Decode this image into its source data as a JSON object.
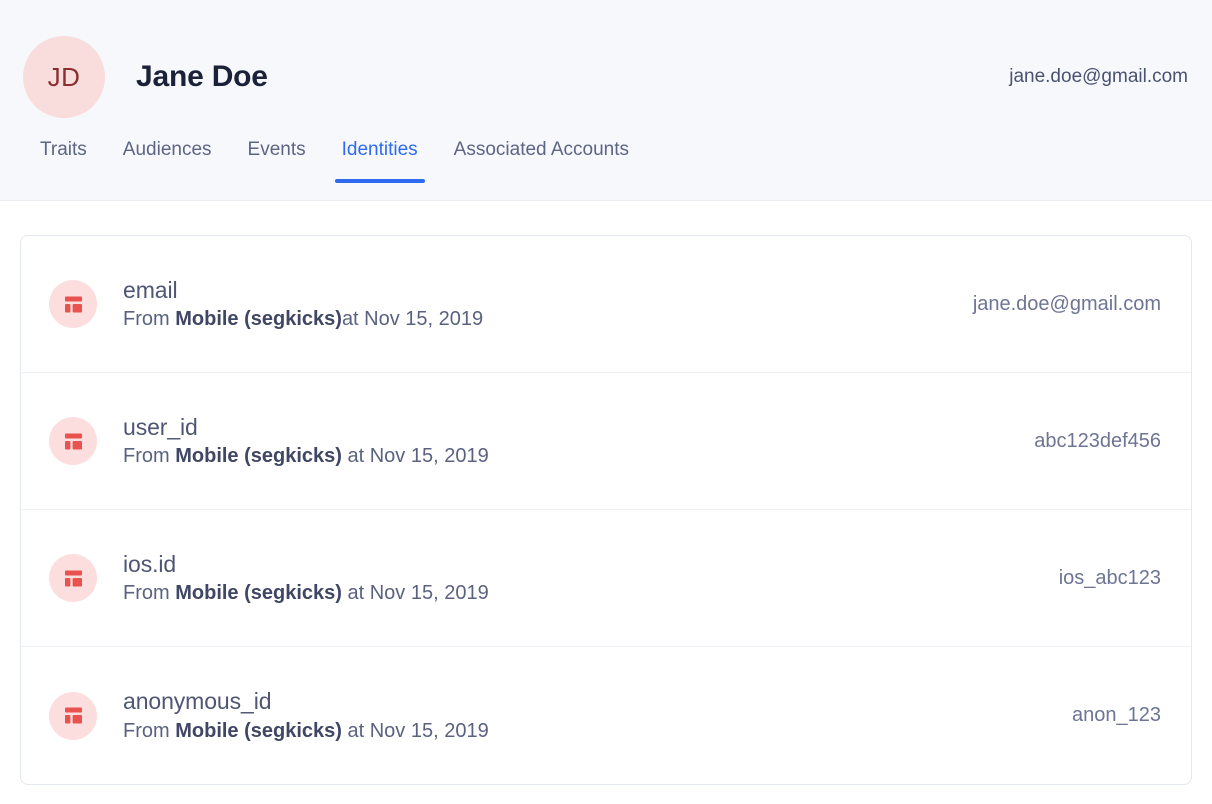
{
  "header": {
    "avatar_initials": "JD",
    "name": "Jane Doe",
    "email": "jane.doe@gmail.com",
    "background_color": "#f7f8fc",
    "avatar_bg_color": "#f9dcdc",
    "avatar_text_color": "#8a2f2f"
  },
  "tabs": {
    "active_color": "#2f6bf0",
    "inactive_color": "#5c6585",
    "items": [
      {
        "label": "Traits",
        "active": false
      },
      {
        "label": "Audiences",
        "active": false
      },
      {
        "label": "Events",
        "active": false
      },
      {
        "label": "Identities",
        "active": true
      },
      {
        "label": "Associated Accounts",
        "active": false
      }
    ]
  },
  "identities": {
    "icon_name": "layout-dashboard-icon",
    "icon_color": "#e8534f",
    "icon_bg_color": "#fbdedd",
    "rows": [
      {
        "key": "email",
        "from_label": "From",
        "source": "Mobile (segkicks)",
        "at_label": "at Nov 15, 2019",
        "space_before_at": false,
        "value": "jane.doe@gmail.com"
      },
      {
        "key": "user_id",
        "from_label": "From",
        "source": "Mobile (segkicks)",
        "at_label": "at Nov 15, 2019",
        "space_before_at": true,
        "value": "abc123def456"
      },
      {
        "key": "ios.id",
        "from_label": "From",
        "source": "Mobile (segkicks)",
        "at_label": "at Nov 15, 2019",
        "space_before_at": true,
        "value": "ios_abc123"
      },
      {
        "key": "anonymous_id",
        "from_label": "From",
        "source": "Mobile (segkicks)",
        "at_label": "at Nov 15, 2019",
        "space_before_at": true,
        "value": "anon_123"
      }
    ]
  }
}
